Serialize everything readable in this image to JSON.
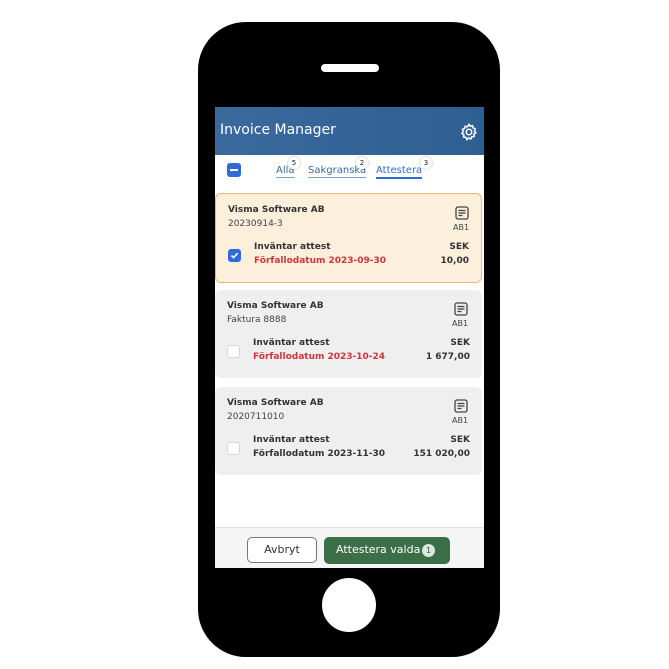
{
  "app": {
    "title": "Invoice Manager",
    "header_color": "#3a6a9d",
    "accent_color": "#2f6bd8",
    "settings_icon": "gear-icon"
  },
  "tabs": [
    {
      "label": "Alla",
      "count": "5"
    },
    {
      "label": "Sakgranska",
      "count": "2"
    },
    {
      "label": "Attestera",
      "count": "3",
      "active": true
    }
  ],
  "invoices": [
    {
      "vendor": "Visma Software AB",
      "reference": "20230914-3",
      "company": "AB1",
      "status": "Inväntar attest",
      "due": "Förfallodatum 2023-09-30",
      "currency": "SEK",
      "amount": "10,00",
      "selected": true,
      "overdue": true
    },
    {
      "vendor": "Visma Software AB",
      "reference": "Faktura 8888",
      "company": "AB1",
      "status": "Inväntar attest",
      "due": "Förfallodatum 2023-10-24",
      "currency": "SEK",
      "amount": "1 677,00",
      "selected": false,
      "overdue": true
    },
    {
      "vendor": "Visma Software AB",
      "reference": "2020711010",
      "company": "AB1",
      "status": "Inväntar attest",
      "due": "Förfallodatum 2023-11-30",
      "currency": "SEK",
      "amount": "151 020,00",
      "selected": false,
      "overdue": false
    }
  ],
  "footer": {
    "cancel_label": "Avbryt",
    "approve_label": "Attestera valda",
    "approve_count": "1",
    "approve_color": "#3c6e47"
  }
}
